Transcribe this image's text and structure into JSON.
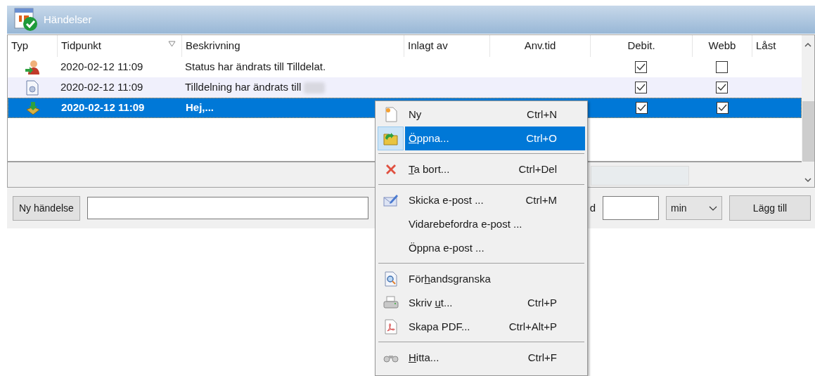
{
  "panel": {
    "title": "Händelser"
  },
  "table": {
    "columns": [
      {
        "label": "Typ",
        "sorted": false
      },
      {
        "label": "Tidpunkt",
        "sorted": true
      },
      {
        "label": "Beskrivning",
        "sorted": false
      },
      {
        "label": "Inlagt av",
        "sorted": false
      },
      {
        "label": "Anv.tid",
        "sorted": false
      },
      {
        "label": "Debit.",
        "sorted": false
      },
      {
        "label": "Webb",
        "sorted": false
      },
      {
        "label": "Låst",
        "sorted": false
      }
    ],
    "rows": [
      {
        "time": "2020-02-12 11:09",
        "description": "Status har ändrats till Tilldelat.",
        "redacted": false,
        "debit": true,
        "web": false,
        "selected": false
      },
      {
        "time": "2020-02-12 11:09",
        "description": "Tilldelning har ändrats till",
        "redacted": true,
        "debit": true,
        "web": true,
        "selected": false
      },
      {
        "time": "2020-02-12 11:09",
        "description": "Hej,...",
        "redacted": false,
        "debit": true,
        "web": true,
        "selected": true
      }
    ]
  },
  "bottom_bar": {
    "new_button": "Ny händelse",
    "time_label": "d",
    "unit": "min",
    "add_button": "Lägg till"
  },
  "context_menu": [
    {
      "kind": "item",
      "label": [
        {
          "text": "Ny",
          "underline": false
        }
      ],
      "shortcut": "Ctrl+N",
      "selected": false
    },
    {
      "kind": "item",
      "label": [
        {
          "text": "Ö",
          "underline": true
        },
        {
          "text": "ppna...",
          "underline": false
        }
      ],
      "shortcut": "Ctrl+O",
      "selected": true
    },
    {
      "kind": "separator"
    },
    {
      "kind": "item",
      "label": [
        {
          "text": "T",
          "underline": true
        },
        {
          "text": "a bort...",
          "underline": false
        }
      ],
      "shortcut": "Ctrl+Del",
      "selected": false
    },
    {
      "kind": "separator"
    },
    {
      "kind": "item",
      "label": [
        {
          "text": "Skicka e-post ...",
          "underline": false
        }
      ],
      "shortcut": "Ctrl+M",
      "selected": false
    },
    {
      "kind": "item",
      "label": [
        {
          "text": "Vidarebefordra e-post ...",
          "underline": false
        }
      ],
      "selected": false
    },
    {
      "kind": "item",
      "label": [
        {
          "text": "Öppna e-post ...",
          "underline": false
        }
      ],
      "selected": false
    },
    {
      "kind": "separator"
    },
    {
      "kind": "item",
      "label": [
        {
          "text": "För",
          "underline": false
        },
        {
          "text": "h",
          "underline": true
        },
        {
          "text": "andsgranska",
          "underline": false
        }
      ],
      "selected": false
    },
    {
      "kind": "item",
      "label": [
        {
          "text": "Skriv ",
          "underline": false
        },
        {
          "text": "u",
          "underline": true
        },
        {
          "text": "t...",
          "underline": false
        }
      ],
      "shortcut": "Ctrl+P",
      "selected": false
    },
    {
      "kind": "item",
      "label": [
        {
          "text": "Skapa PDF...",
          "underline": false
        }
      ],
      "shortcut": "Ctrl+Alt+P",
      "selected": false
    },
    {
      "kind": "separator"
    },
    {
      "kind": "item",
      "label": [
        {
          "text": "H",
          "underline": true
        },
        {
          "text": "itta...",
          "underline": false
        }
      ],
      "shortcut": "Ctrl+F",
      "selected": false
    }
  ]
}
